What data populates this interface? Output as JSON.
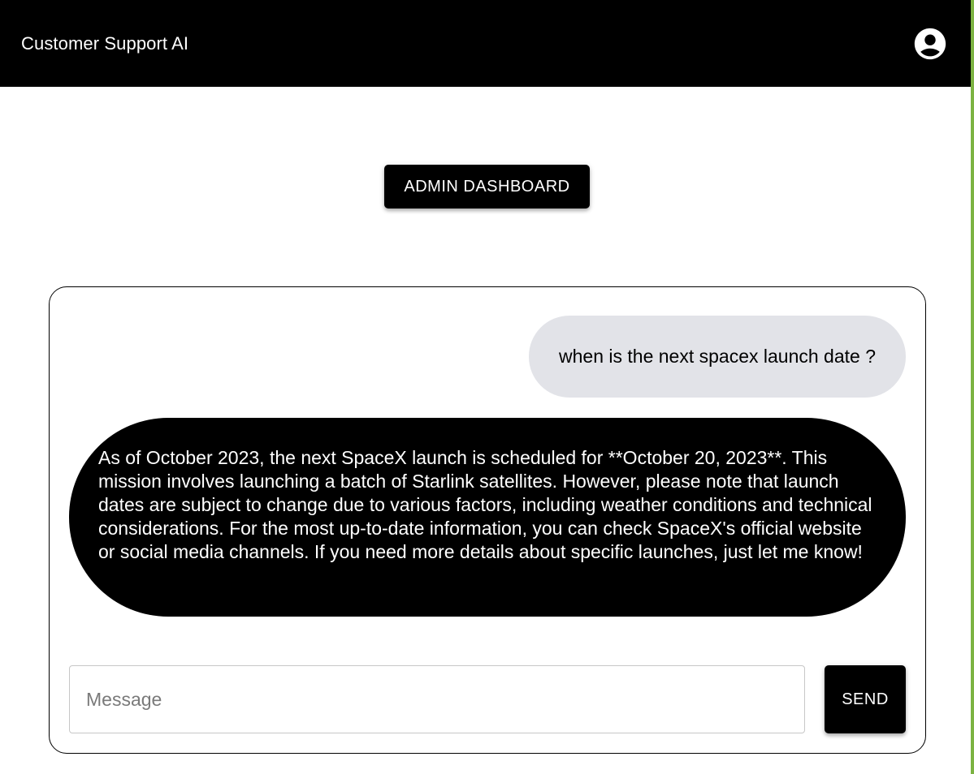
{
  "app": {
    "title": "Customer Support AI",
    "account_icon": "account-circle-icon"
  },
  "admin": {
    "button_label": "ADMIN DASHBOARD"
  },
  "chat": {
    "messages": [
      {
        "role": "user",
        "text": "when is the next spacex launch date ?"
      },
      {
        "role": "assistant",
        "text": "As of October 2023, the next SpaceX launch is scheduled for **October 20, 2023**. This mission involves launching a batch of Starlink satellites. However, please note that launch dates are subject to change due to various factors, including weather conditions and technical considerations. For the most up-to-date information, you can check SpaceX's official website or social media channels. If you need more details about specific launches, just let me know!"
      }
    ],
    "input": {
      "placeholder": "Message",
      "value": ""
    },
    "send_label": "SEND"
  },
  "colors": {
    "appbar_bg": "#000000",
    "primary": "#000000",
    "user_bubble_bg": "#e2e3e8",
    "user_bubble_text": "#000000",
    "assistant_bubble_bg": "#000000",
    "assistant_bubble_text": "#ffffff",
    "edge_accent": "#7cb342"
  }
}
